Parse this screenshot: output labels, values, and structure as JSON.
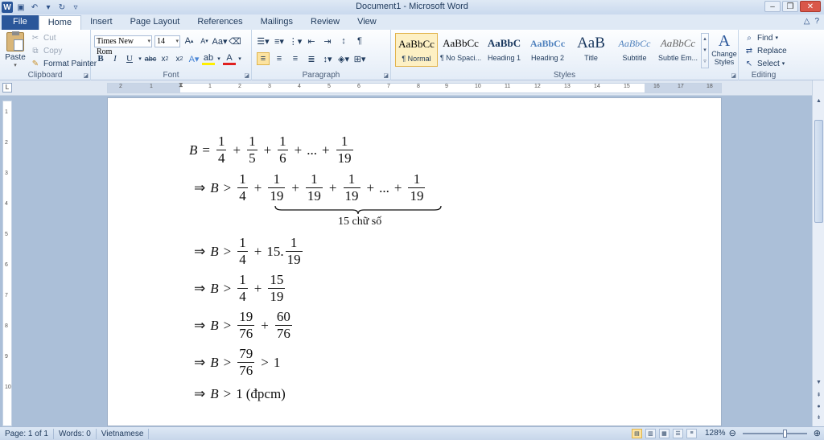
{
  "window": {
    "title": "Document1 - Microsoft Word"
  },
  "tabs": [
    "File",
    "Home",
    "Insert",
    "Page Layout",
    "References",
    "Mailings",
    "Review",
    "View"
  ],
  "clipboard": {
    "paste": "Paste",
    "cut": "Cut",
    "copy": "Copy",
    "format_painter": "Format Painter",
    "label": "Clipboard"
  },
  "font": {
    "name": "Times New Rom",
    "size": "14",
    "label": "Font"
  },
  "paragraph": {
    "label": "Paragraph"
  },
  "styles": {
    "label": "Styles",
    "items": [
      {
        "sample": "AaBbCc",
        "name": "¶ Normal"
      },
      {
        "sample": "AaBbCc",
        "name": "¶ No Spaci..."
      },
      {
        "sample": "AaBbC",
        "name": "Heading 1"
      },
      {
        "sample": "AaBbCc",
        "name": "Heading 2"
      },
      {
        "sample": "AaB",
        "name": "Title"
      },
      {
        "sample": "AaBbCc",
        "name": "Subtitle"
      },
      {
        "sample": "AaBbCc",
        "name": "Subtle Em..."
      }
    ],
    "change_styles": "Change Styles"
  },
  "editing": {
    "find": "Find",
    "replace": "Replace",
    "select": "Select",
    "label": "Editing"
  },
  "ruler": {
    "marks": [
      "2",
      "1",
      "1",
      "2",
      "3",
      "4",
      "5",
      "6",
      "7",
      "8",
      "9",
      "10",
      "11",
      "12",
      "13",
      "14",
      "15",
      "16",
      "17",
      "18"
    ]
  },
  "vruler": {
    "marks": [
      "1",
      "2",
      "3",
      "4",
      "5",
      "6",
      "7",
      "8",
      "9",
      "10"
    ]
  },
  "status": {
    "page": "Page: 1 of 1",
    "words": "Words: 0",
    "language": "Vietnamese",
    "zoom": "128%"
  },
  "doc": {
    "l1": {
      "B": "B",
      "eq": "=",
      "f1n": "1",
      "f1d": "4",
      "p1": "+",
      "f2n": "1",
      "f2d": "5",
      "p2": "+",
      "f3n": "1",
      "f3d": "6",
      "p3": "+",
      "dots": "...",
      "p4": "+",
      "f4n": "1",
      "f4d": "19"
    },
    "l2": {
      "imp": "⇒",
      "B": "B",
      "gt": ">",
      "f1n": "1",
      "f1d": "4",
      "p1": "+",
      "f2n": "1",
      "f2d": "19",
      "p2": "+",
      "f3n": "1",
      "f3d": "19",
      "p3": "+",
      "f4n": "1",
      "f4d": "19",
      "p4": "+",
      "dots": "...",
      "p5": "+",
      "f5n": "1",
      "f5d": "19",
      "brace_label": "15 chữ số"
    },
    "l3": {
      "imp": "⇒",
      "B": "B",
      "gt": ">",
      "f1n": "1",
      "f1d": "4",
      "p1": "+",
      "k": "15.",
      "f2n": "1",
      "f2d": "19"
    },
    "l4": {
      "imp": "⇒",
      "B": "B",
      "gt": ">",
      "f1n": "1",
      "f1d": "4",
      "p1": "+",
      "f2n": "15",
      "f2d": "19"
    },
    "l5": {
      "imp": "⇒",
      "B": "B",
      "gt": ">",
      "f1n": "19",
      "f1d": "76",
      "p1": "+",
      "f2n": "60",
      "f2d": "76"
    },
    "l6": {
      "imp": "⇒",
      "B": "B",
      "gt": ">",
      "f1n": "79",
      "f1d": "76",
      "gt2": ">",
      "one": "1"
    },
    "l7": {
      "imp": "⇒",
      "B": "B",
      "gt": ">",
      "one": "1",
      "note": "(đpcm)"
    }
  }
}
